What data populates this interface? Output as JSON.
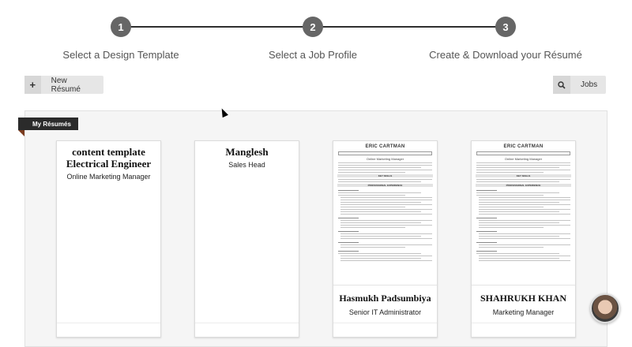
{
  "stepper": {
    "steps": [
      {
        "number": "1",
        "label": "Select a Design Template"
      },
      {
        "number": "2",
        "label": "Select a Job Profile"
      },
      {
        "number": "3",
        "label": "Create & Download your Résumé"
      }
    ]
  },
  "toolbar": {
    "new_resume_icon": "+",
    "new_resume_label": "New Résumé",
    "jobs_icon": "search-icon",
    "jobs_label": "Jobs"
  },
  "panel": {
    "ribbon_label": "My Résumés",
    "cards": [
      {
        "name": "content template Electrical Engineer",
        "role": "Online Marketing Manager"
      },
      {
        "name": "Manglesh",
        "role": "Sales Head"
      },
      {
        "thumb_name": "ERIC CARTMAN",
        "thumb_title": "Online Marketing Manager",
        "thumb_bar1": "KEY SKILLS",
        "thumb_bar2": "PROFESSIONAL EXPERIENCE",
        "name": "Hasmukh Padsumbiya",
        "role": "Senior IT Administrator"
      },
      {
        "thumb_name": "ERIC CARTMAN",
        "thumb_title": "Online Marketing Manager",
        "thumb_bar1": "KEY SKILLS",
        "thumb_bar2": "PROFESSIONAL EXPERIENCE",
        "name": "SHAHRUKH KHAN",
        "role": "Marketing Manager"
      }
    ]
  },
  "colors": {
    "step_circle": "#666666",
    "ribbon": "#2b2b2b",
    "button_bg": "#e6e6e6"
  }
}
